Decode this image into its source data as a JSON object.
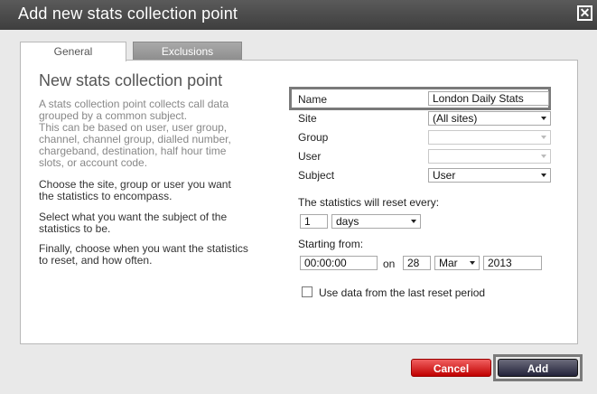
{
  "window": {
    "title": "Add new stats collection point"
  },
  "tabs": {
    "general": "General",
    "exclusions": "Exclusions"
  },
  "panel": {
    "heading": "New stats collection point",
    "intro_lines": [
      "A stats collection point collects call data",
      "grouped by a common subject.",
      "This can be based on user, user group,",
      "channel, channel group, dialled number,",
      "chargeband, destination, half hour time",
      "slots, or account code."
    ],
    "p2_lines": [
      "Choose the site, group or user you want",
      "the statistics to encompass."
    ],
    "p3_lines": [
      "Select what you want the subject of the",
      "statistics to be."
    ],
    "p4_lines": [
      "Finally, choose when you want the statistics",
      "to reset, and how often."
    ]
  },
  "form": {
    "name_label": "Name",
    "name_value": "London Daily Stats",
    "site_label": "Site",
    "site_value": "(All sites)",
    "group_label": "Group",
    "group_value": "",
    "user_label": "User",
    "user_value": "",
    "subject_label": "Subject",
    "subject_value": "User",
    "reset_label": "The statistics will reset every:",
    "reset_count": "1",
    "reset_unit": "days",
    "starting_label": "Starting from:",
    "start_time": "00:00:00",
    "on_label": "on",
    "start_day": "28",
    "start_month": "Mar",
    "start_year": "2013",
    "use_data_label": "Use data from the last reset period",
    "use_data_checked": false
  },
  "buttons": {
    "cancel": "Cancel",
    "add": "Add"
  }
}
